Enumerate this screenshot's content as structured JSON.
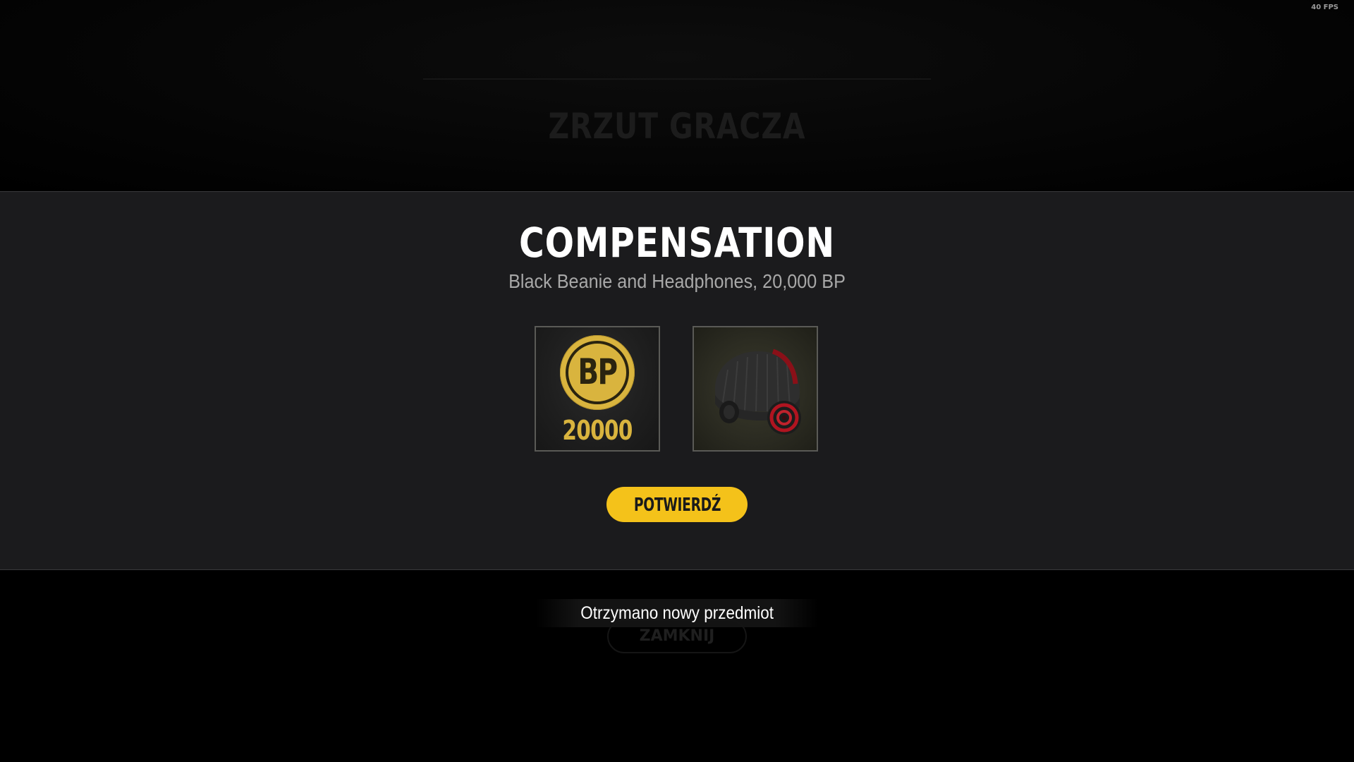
{
  "overlay": {
    "fps_label": "40 FPS"
  },
  "background_page": {
    "title": "ZRZUT GRACZA",
    "ghost_button_label": "ZAMKNIJ"
  },
  "modal": {
    "title": "COMPENSATION",
    "subtitle": "Black Beanie and Headphones, 20,000 BP",
    "items": [
      {
        "type": "currency",
        "coin_label": "BP",
        "amount": "20000",
        "icon": "bp-coin-icon"
      },
      {
        "type": "cosmetic",
        "icon": "beanie-headphones-icon"
      }
    ],
    "confirm_label": "POTWIERDŹ"
  },
  "toast": {
    "message": "Otrzymano nowy przedmiot"
  },
  "colors": {
    "accent_yellow": "#f4c21a",
    "coin_gold": "#d9b43e",
    "modal_bg": "#1b1b1d"
  }
}
